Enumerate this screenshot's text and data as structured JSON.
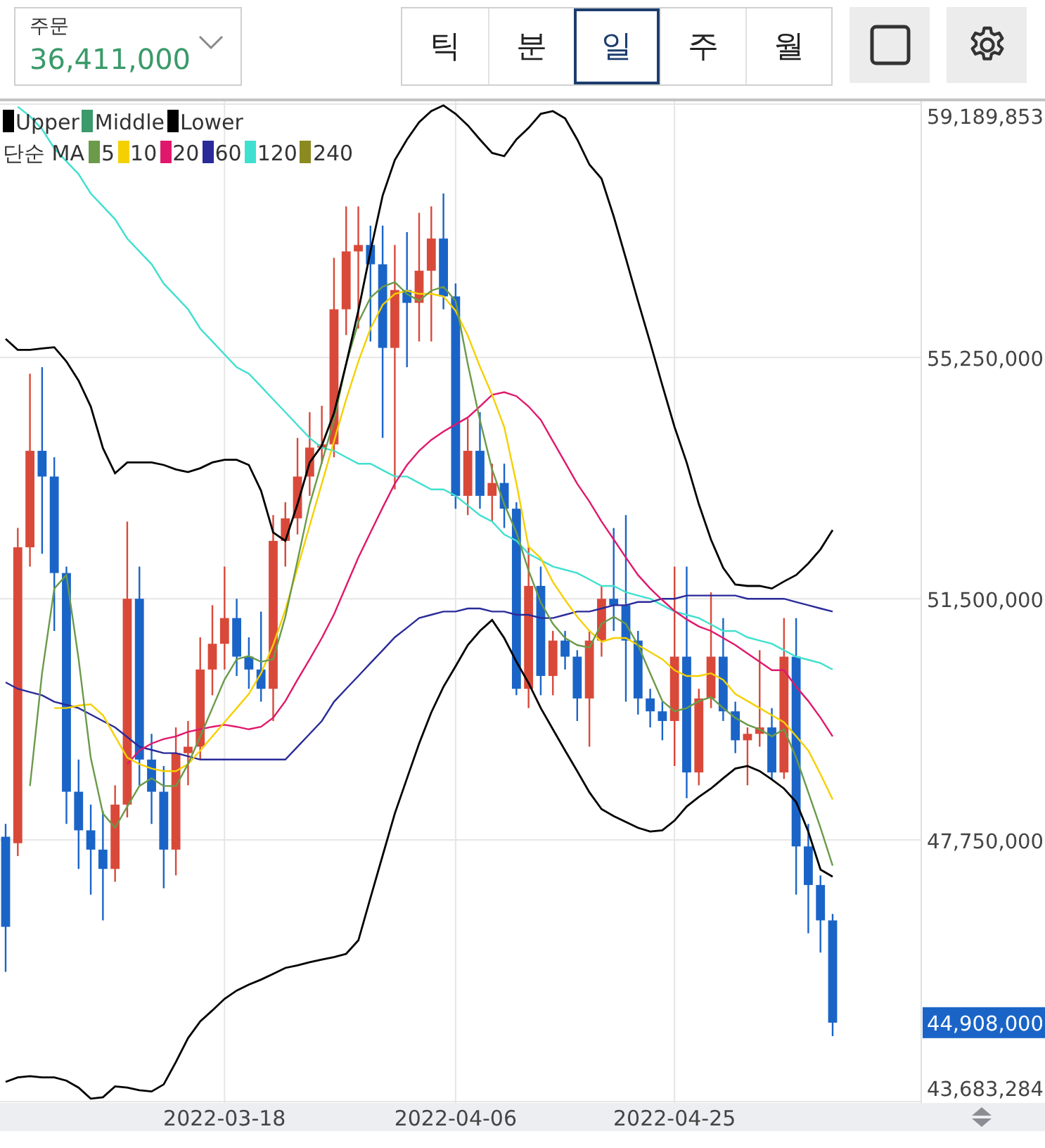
{
  "order": {
    "label": "주문",
    "value": "36,411,000"
  },
  "periods": [
    {
      "label": "틱",
      "selected": false
    },
    {
      "label": "분",
      "selected": false
    },
    {
      "label": "일",
      "selected": true
    },
    {
      "label": "주",
      "selected": false
    },
    {
      "label": "월",
      "selected": false
    }
  ],
  "ma_title": "단순 MA",
  "legend_only": [
    {
      "label": "Middle",
      "color": "#3a9a6a"
    },
    {
      "label": "240",
      "color": "#8a8a20"
    }
  ],
  "last_price": {
    "label": "44,908,000"
  },
  "price_chart": {
    "chart_data": {
      "type": "candlestick",
      "grid": true,
      "ylim": [
        43683284,
        59189853
      ],
      "categories": [
        null,
        null,
        null,
        null,
        null,
        null,
        null,
        null,
        null,
        null,
        null,
        null,
        null,
        null,
        null,
        null,
        null,
        null,
        null,
        null,
        null,
        null,
        null,
        null,
        null,
        null,
        null,
        null,
        null,
        null,
        null,
        null,
        null,
        null,
        null,
        null,
        null,
        null,
        null,
        null,
        null,
        null,
        null,
        null,
        null,
        null,
        null,
        null,
        null,
        null,
        null,
        null,
        null,
        null,
        null,
        null,
        null,
        null,
        null,
        null,
        null,
        null,
        null,
        null,
        null,
        null,
        null,
        null,
        null
      ],
      "ohlc": [
        [
          47800000.0,
          48000000.0,
          45700000.0,
          46400000.0
        ],
        [
          47700000.0,
          52600000.0,
          47500000.0,
          52300000.0
        ],
        [
          52300000.0,
          55000000.0,
          52000000.0,
          53800000.0
        ],
        [
          53800000.0,
          55100000.0,
          52200000.0,
          53400000.0
        ],
        [
          53400000.0,
          53700000.0,
          51000000.0,
          51900000.0
        ],
        [
          51900000.0,
          52000000.0,
          48000000.0,
          48500000.0
        ],
        [
          48500000.0,
          49000000.0,
          47300000.0,
          47900000.0
        ],
        [
          47900000.0,
          48300000.0,
          46900000.0,
          47600000.0
        ],
        [
          47600000.0,
          48200000.0,
          46500000.0,
          47300000.0
        ],
        [
          47300000.0,
          48600000.0,
          47100000.0,
          48300000.0
        ],
        [
          48300000.0,
          52700000.0,
          48100000.0,
          51500000.0
        ],
        [
          51500000.0,
          52000000.0,
          48600000.0,
          49000000.0
        ],
        [
          49000000.0,
          49400000.0,
          48000000.0,
          48500000.0
        ],
        [
          48500000.0,
          48900000.0,
          47000000.0,
          47600000.0
        ],
        [
          47600000.0,
          49500000.0,
          47200000.0,
          49100000.0
        ],
        [
          49100000.0,
          49600000.0,
          48600000.0,
          49200000.0
        ],
        [
          49200000.0,
          50900000.0,
          49000000.0,
          50400000.0
        ],
        [
          50400000.0,
          51400000.0,
          50000000.0,
          50800000.0
        ],
        [
          50800000.0,
          52000000.0,
          50400000.0,
          51200000.0
        ],
        [
          51200000.0,
          51500000.0,
          50300000.0,
          50600000.0
        ],
        [
          50600000.0,
          50900000.0,
          50100000.0,
          50400000.0
        ],
        [
          50400000.0,
          51300000.0,
          49900000.0,
          50100000.0
        ],
        [
          50100000.0,
          52800000.0,
          49600000.0,
          52400000.0
        ],
        [
          52400000.0,
          53000000.0,
          52000000.0,
          52750000.0
        ],
        [
          52750000.0,
          54000000.0,
          52500000.0,
          53400000.0
        ],
        [
          53400000.0,
          54400000.0,
          53100000.0,
          53850000.0
        ],
        [
          53850000.0,
          54500000.0,
          53600000.0,
          53900000.0
        ],
        [
          53900000.0,
          56800000.0,
          53700000.0,
          56000000.0
        ],
        [
          56000000.0,
          57600000.0,
          55600000.0,
          56900000.0
        ],
        [
          56900000.0,
          57600000.0,
          55700000.0,
          57000000.0
        ],
        [
          57000000.0,
          57300000.0,
          55500000.0,
          56700000.0
        ],
        [
          56700000.0,
          57300000.0,
          54000000.0,
          55400000.0
        ],
        [
          55400000.0,
          57000000.0,
          53200000.0,
          56300000.0
        ],
        [
          56300000.0,
          57200000.0,
          55100000.0,
          56100000.0
        ],
        [
          56100000.0,
          57500000.0,
          55500000.0,
          56600000.0
        ],
        [
          56600000.0,
          57600000.0,
          55500000.0,
          57100000.0
        ],
        [
          57100000.0,
          57800000.0,
          56000000.0,
          56200000.0
        ],
        [
          56200000.0,
          56400000.0,
          52900000.0,
          53100000.0
        ],
        [
          53100000.0,
          54300000.0,
          52800000.0,
          53800000.0
        ],
        [
          53800000.0,
          54400000.0,
          52900000.0,
          53100000.0
        ],
        [
          53100000.0,
          53600000.0,
          52700000.0,
          53300000.0
        ],
        [
          53300000.0,
          53600000.0,
          52600000.0,
          52900000.0
        ],
        [
          52900000.0,
          53000000.0,
          50000000.0,
          50100000.0
        ],
        [
          50100000.0,
          52300000.0,
          49800000.0,
          51700000.0
        ],
        [
          51700000.0,
          52000000.0,
          50000000.0,
          50300000.0
        ],
        [
          50300000.0,
          51000000.0,
          50000000.0,
          50850000.0
        ],
        [
          50850000.0,
          51000000.0,
          50400000.0,
          50600000.0
        ],
        [
          50600000.0,
          50700000.0,
          49600000.0,
          49950000.0
        ],
        [
          49950000.0,
          51000000.0,
          49200000.0,
          50850000.0
        ],
        [
          50850000.0,
          51700000.0,
          50600000.0,
          51500000.0
        ],
        [
          51500000.0,
          52600000.0,
          51000000.0,
          51400000.0
        ],
        [
          51400000.0,
          52800000.0,
          49900000.0,
          50850000.0
        ],
        [
          50850000.0,
          51000000.0,
          49700000.0,
          49950000.0
        ],
        [
          49950000.0,
          50100000.0,
          49500000.0,
          49750000.0
        ],
        [
          49750000.0,
          49900000.0,
          49300000.0,
          49600000.0
        ],
        [
          49600000.0,
          52000000.0,
          48900000.0,
          50600000.0
        ],
        [
          50600000.0,
          52000000.0,
          48400000.0,
          48800000.0
        ],
        [
          48800000.0,
          50100000.0,
          48600000.0,
          49950000.0
        ],
        [
          49950000.0,
          51600000.0,
          49800000.0,
          50600000.0
        ],
        [
          50600000.0,
          51200000.0,
          49600000.0,
          49750000.0
        ],
        [
          49750000.0,
          49900000.0,
          49100000.0,
          49300000.0
        ],
        [
          49300000.0,
          49500000.0,
          48600000.0,
          49400000.0
        ],
        [
          49400000.0,
          50700000.0,
          49200000.0,
          49500000.0
        ],
        [
          49500000.0,
          49800000.0,
          48700000.0,
          48800000.0
        ],
        [
          48800000.0,
          51200000.0,
          48700000.0,
          50600000.0
        ],
        [
          50600000.0,
          51200000.0,
          46900000.0,
          47650000.0
        ],
        [
          47650000.0,
          48000000.0,
          46300000.0,
          47050000.0
        ],
        [
          47050000.0,
          47200000.0,
          46000000.0,
          46500000.0
        ],
        [
          46500000.0,
          46600000.0,
          44700000.0,
          44910000.0
        ]
      ]
    }
  },
  "indicators": {
    "chart_data": {
      "type": "line",
      "ylim": [
        43683284,
        59189853
      ],
      "yticks": [
        {
          "value": 59189853,
          "label": "59,189,853"
        },
        {
          "value": 55250000,
          "label": "55,250,000"
        },
        {
          "value": 51500000,
          "label": "51,500,000"
        },
        {
          "value": 47750000,
          "label": "47,750,000"
        },
        {
          "value": 43683284,
          "label": "43,683,284"
        }
      ],
      "categories": [
        null,
        null,
        null,
        null,
        null,
        null,
        null,
        null,
        null,
        null,
        null,
        null,
        null,
        null,
        null,
        null,
        null,
        null,
        "2022-03-18",
        null,
        null,
        null,
        null,
        null,
        null,
        null,
        null,
        null,
        null,
        null,
        null,
        null,
        null,
        null,
        null,
        null,
        null,
        "2022-04-06",
        null,
        null,
        null,
        null,
        null,
        null,
        null,
        null,
        null,
        null,
        null,
        null,
        null,
        null,
        null,
        null,
        null,
        "2022-04-25",
        null,
        null,
        null,
        null,
        null,
        null,
        null,
        null,
        null,
        null,
        null,
        null,
        null
      ],
      "series": [
        {
          "name": "Upper",
          "color": "#000000",
          "values": [
            55540000.0,
            55370000.0,
            55370000.0,
            55390000.0,
            55410000.0,
            55190000.0,
            54890000.0,
            54490000.0,
            53840000.0,
            53450000.0,
            53620000.0,
            53620000.0,
            53620000.0,
            53580000.0,
            53510000.0,
            53470000.0,
            53530000.0,
            53620000.0,
            53660000.0,
            53660000.0,
            53580000.0,
            53180000.0,
            52530000.0,
            52400000.0,
            52970000.0,
            53620000.0,
            53880000.0,
            54390000.0,
            55150000.0,
            55980000.0,
            56900000.0,
            57770000.0,
            58320000.0,
            58640000.0,
            58910000.0,
            59080000.0,
            59170000.0,
            59040000.0,
            58860000.0,
            58640000.0,
            58430000.0,
            58380000.0,
            58640000.0,
            58820000.0,
            59040000.0,
            59080000.0,
            58970000.0,
            58640000.0,
            58250000.0,
            58030000.0,
            57440000.0,
            56790000.0,
            56130000.0,
            55480000.0,
            54820000.0,
            54170000.0,
            53620000.0,
            52970000.0,
            52420000.0,
            51980000.0,
            51720000.0,
            51700000.0,
            51700000.0,
            51660000.0,
            51770000.0,
            51870000.0,
            52050000.0,
            52270000.0,
            52570000.0
          ]
        },
        {
          "name": "Lower",
          "color": "#000000",
          "values": [
            43990000.0,
            44060000.0,
            44080000.0,
            44060000.0,
            44060000.0,
            44010000.0,
            43900000.0,
            43730000.0,
            43750000.0,
            43920000.0,
            43900000.0,
            43860000.0,
            43840000.0,
            43950000.0,
            44300000.0,
            44670000.0,
            44930000.0,
            45100000.0,
            45280000.0,
            45410000.0,
            45500000.0,
            45580000.0,
            45670000.0,
            45760000.0,
            45800000.0,
            45850000.0,
            45890000.0,
            45930000.0,
            45980000.0,
            46190000.0,
            46850000.0,
            47510000.0,
            48160000.0,
            48710000.0,
            49250000.0,
            49730000.0,
            50130000.0,
            50450000.0,
            50780000.0,
            51000000.0,
            51170000.0,
            50890000.0,
            50520000.0,
            50190000.0,
            49800000.0,
            49470000.0,
            49140000.0,
            48820000.0,
            48490000.0,
            48230000.0,
            48120000.0,
            48030000.0,
            47940000.0,
            47880000.0,
            47900000.0,
            48050000.0,
            48270000.0,
            48420000.0,
            48550000.0,
            48710000.0,
            48860000.0,
            48900000.0,
            48820000.0,
            48690000.0,
            48550000.0,
            48340000.0,
            47880000.0,
            47290000.0,
            47180000.0
          ]
        },
        {
          "name": "5",
          "color": "#6a9a4a",
          "values": [
            null,
            null,
            48590000.0,
            50340000.0,
            51660000.0,
            51870000.0,
            50560000.0,
            49030000.0,
            48160000.0,
            47940000.0,
            48270000.0,
            48590000.0,
            48710000.0,
            48590000.0,
            48590000.0,
            48930000.0,
            49360000.0,
            49800000.0,
            50240000.0,
            50560000.0,
            50610000.0,
            50520000.0,
            50560000.0,
            51220000.0,
            52090000.0,
            52970000.0,
            53620000.0,
            54280000.0,
            55150000.0,
            55800000.0,
            56180000.0,
            56350000.0,
            56420000.0,
            56240000.0,
            56130000.0,
            56290000.0,
            56350000.0,
            56130000.0,
            55150000.0,
            54280000.0,
            53510000.0,
            52970000.0,
            52530000.0,
            51940000.0,
            51440000.0,
            51110000.0,
            50890000.0,
            50780000.0,
            50740000.0,
            51110000.0,
            51220000.0,
            51110000.0,
            50780000.0,
            50340000.0,
            49910000.0,
            49750000.0,
            49800000.0,
            49910000.0,
            49970000.0,
            49800000.0,
            49650000.0,
            49540000.0,
            49470000.0,
            49360000.0,
            49470000.0,
            49030000.0,
            48490000.0,
            47940000.0,
            47350000.0
          ]
        },
        {
          "name": "10",
          "color": "#f5d000",
          "values": [
            null,
            null,
            null,
            null,
            49800000.0,
            49800000.0,
            49840000.0,
            49860000.0,
            49690000.0,
            49360000.0,
            49030000.0,
            48930000.0,
            48860000.0,
            48820000.0,
            48820000.0,
            48930000.0,
            49140000.0,
            49360000.0,
            49580000.0,
            49800000.0,
            50020000.0,
            50340000.0,
            50780000.0,
            51330000.0,
            51980000.0,
            52640000.0,
            53290000.0,
            53950000.0,
            54600000.0,
            55190000.0,
            55700000.0,
            56070000.0,
            56240000.0,
            56290000.0,
            56240000.0,
            56240000.0,
            56200000.0,
            55980000.0,
            55590000.0,
            55110000.0,
            54670000.0,
            54170000.0,
            53290000.0,
            52310000.0,
            52130000.0,
            51760000.0,
            51480000.0,
            51220000.0,
            51000000.0,
            50830000.0,
            50890000.0,
            50890000.0,
            50780000.0,
            50670000.0,
            50560000.0,
            50390000.0,
            50300000.0,
            50300000.0,
            50340000.0,
            50240000.0,
            50020000.0,
            49910000.0,
            49800000.0,
            49690000.0,
            49580000.0,
            49360000.0,
            49140000.0,
            48770000.0,
            48380000.0
          ]
        },
        {
          "name": "20",
          "color": "#e0186c",
          "values": [
            null,
            null,
            null,
            null,
            null,
            null,
            null,
            null,
            null,
            null,
            48930000.0,
            49140000.0,
            49250000.0,
            49320000.0,
            49360000.0,
            49430000.0,
            49470000.0,
            49510000.0,
            49540000.0,
            49510000.0,
            49470000.0,
            49510000.0,
            49650000.0,
            49910000.0,
            50240000.0,
            50560000.0,
            50890000.0,
            51260000.0,
            51700000.0,
            52140000.0,
            52530000.0,
            52920000.0,
            53290000.0,
            53580000.0,
            53800000.0,
            53970000.0,
            54100000.0,
            54210000.0,
            54320000.0,
            54490000.0,
            54670000.0,
            54710000.0,
            54650000.0,
            54490000.0,
            54280000.0,
            53950000.0,
            53620000.0,
            53290000.0,
            53010000.0,
            52700000.0,
            52420000.0,
            52140000.0,
            51870000.0,
            51660000.0,
            51480000.0,
            51310000.0,
            51180000.0,
            51070000.0,
            51000000.0,
            50890000.0,
            50780000.0,
            50650000.0,
            50520000.0,
            50390000.0,
            50390000.0,
            50130000.0,
            49910000.0,
            49650000.0,
            49360000.0
          ]
        },
        {
          "name": "60",
          "color": "#2a2a9a",
          "values": [
            50200000.0,
            50100000.0,
            50050000.0,
            50000000.0,
            49900000.0,
            49850000.0,
            49800000.0,
            49700000.0,
            49600000.0,
            49500000.0,
            49350000.0,
            49200000.0,
            49150000.0,
            49100000.0,
            49100000.0,
            49050000.0,
            49000000.0,
            49000000.0,
            49000000.0,
            49000000.0,
            49000000.0,
            49000000.0,
            49000000.0,
            49000000.0,
            49200000.0,
            49400000.0,
            49600000.0,
            49900000.0,
            50100000.0,
            50300000.0,
            50500000.0,
            50700000.0,
            50900000.0,
            51050000.0,
            51200000.0,
            51250000.0,
            51300000.0,
            51300000.0,
            51350000.0,
            51350000.0,
            51300000.0,
            51300000.0,
            51250000.0,
            51250000.0,
            51200000.0,
            51200000.0,
            51250000.0,
            51300000.0,
            51300000.0,
            51350000.0,
            51400000.0,
            51400000.0,
            51450000.0,
            51450000.0,
            51500000.0,
            51500000.0,
            51550000.0,
            51550000.0,
            51550000.0,
            51550000.0,
            51550000.0,
            51500000.0,
            51500000.0,
            51500000.0,
            51500000.0,
            51450000.0,
            51400000.0,
            51350000.0,
            51300000.0
          ]
        },
        {
          "name": "120",
          "color": "#40e0d0",
          "values": [
            null,
            59150000.0,
            59000000.0,
            58800000.0,
            58500000.0,
            58300000.0,
            58100000.0,
            57800000.0,
            57600000.0,
            57400000.0,
            57100000.0,
            56900000.0,
            56700000.0,
            56400000.0,
            56200000.0,
            56000000.0,
            55700000.0,
            55500000.0,
            55300000.0,
            55100000.0,
            55000000.0,
            54800000.0,
            54600000.0,
            54400000.0,
            54200000.0,
            54000000.0,
            53850000.0,
            53800000.0,
            53700000.0,
            53600000.0,
            53600000.0,
            53500000.0,
            53400000.0,
            53400000.0,
            53300000.0,
            53200000.0,
            53200000.0,
            53100000.0,
            52950000.0,
            52800000.0,
            52700000.0,
            52500000.0,
            52400000.0,
            52200000.0,
            52100000.0,
            52000000.0,
            51950000.0,
            51900000.0,
            51800000.0,
            51700000.0,
            51700000.0,
            51600000.0,
            51550000.0,
            51500000.0,
            51400000.0,
            51300000.0,
            51250000.0,
            51200000.0,
            51100000.0,
            51000000.0,
            51000000.0,
            50900000.0,
            50850000.0,
            50800000.0,
            50700000.0,
            50600000.0,
            50550000.0,
            50500000.0,
            50400000.0
          ]
        }
      ]
    }
  }
}
